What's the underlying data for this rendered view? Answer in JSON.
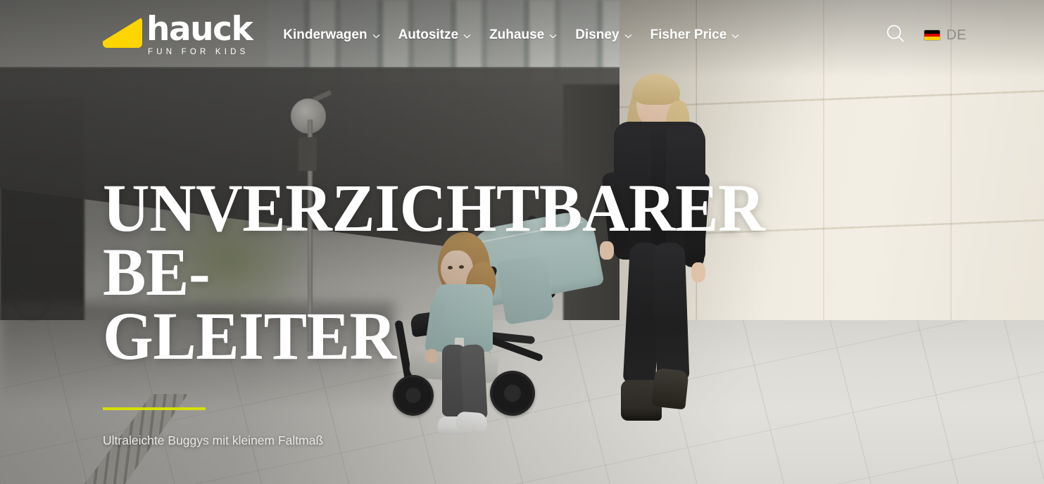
{
  "header": {
    "logo": {
      "word": "hauck",
      "tagline": "FUN FOR KIDS",
      "mark_color": "#ffd500"
    },
    "nav": [
      {
        "label": "Kinderwagen",
        "has_dropdown": true
      },
      {
        "label": "Autositze",
        "has_dropdown": true
      },
      {
        "label": "Zuhause",
        "has_dropdown": true
      },
      {
        "label": "Disney",
        "has_dropdown": true
      },
      {
        "label": "Fisher Price",
        "has_dropdown": true
      }
    ],
    "search_icon": "search-icon",
    "language": {
      "code": "DE",
      "flag": "german-flag-icon",
      "flag_colors": [
        "#000000",
        "#dd0000",
        "#ffce00"
      ]
    }
  },
  "hero": {
    "title": "Unverzichtbarer Be-\nGleiter",
    "rule_color": "#d6e000",
    "subtitle": "Ultraleichte Buggys mit kleinem Faltmaß"
  },
  "background": {
    "description": "Frau schiebt Buggy, Kleinkind daneben, urbane Szene",
    "stroller_color": "#b4cbc7",
    "scrim_color": "#1a1a1a"
  }
}
